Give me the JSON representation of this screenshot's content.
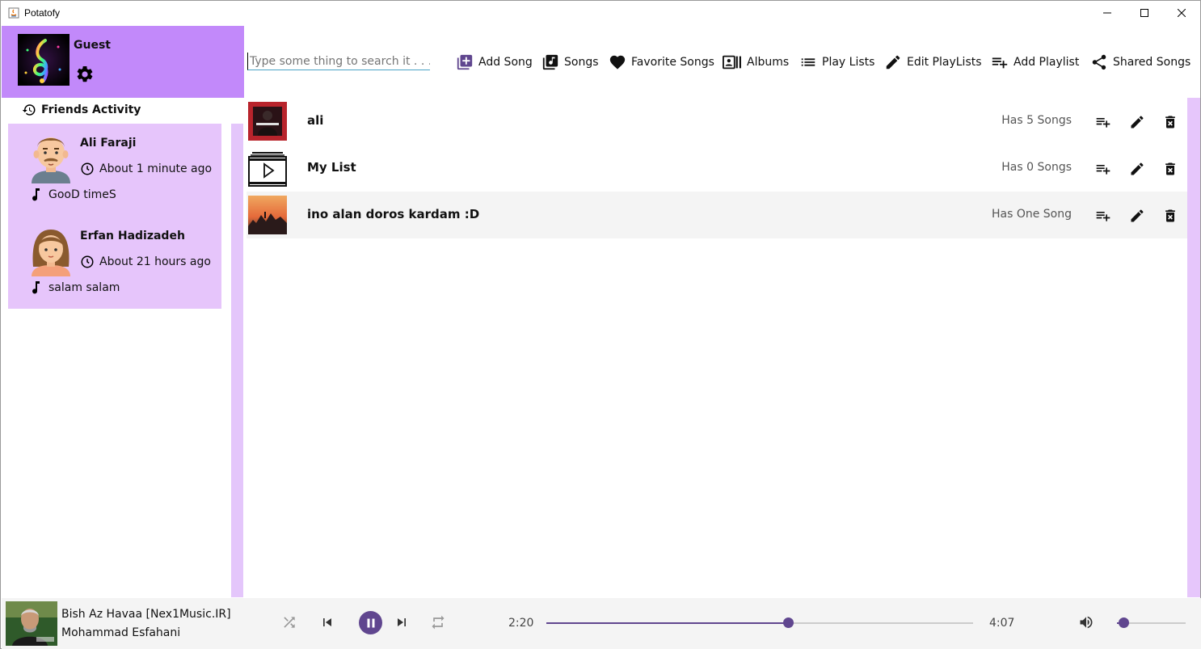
{
  "window": {
    "title": "Potatofy"
  },
  "profile": {
    "username": "Guest"
  },
  "friends": {
    "heading": "Friends Activity",
    "items": [
      {
        "name": "Ali Faraji",
        "time": "About 1 minute ago",
        "song": "GooD timeS"
      },
      {
        "name": "Erfan Hadizadeh",
        "time": "About 21 hours ago",
        "song": "salam salam"
      }
    ]
  },
  "search": {
    "placeholder": "Type some thing to search it . . ."
  },
  "nav": {
    "add_song": "Add Song",
    "songs": "Songs",
    "favorite_songs": "Favorite Songs",
    "albums": "Albums",
    "play_lists": "Play Lists",
    "edit_playlists": "Edit PlayLists",
    "add_playlist": "Add Playlist",
    "shared_songs": "Shared Songs"
  },
  "playlists": [
    {
      "name": "ali",
      "count": "Has 5 Songs"
    },
    {
      "name": "My List",
      "count": "Has 0 Songs"
    },
    {
      "name": "ino alan doros kardam :D",
      "count": "Has One Song"
    }
  ],
  "player": {
    "title": "Bish Az Havaa [Nex1Music.IR]",
    "artist": "Mohammad Esfahani",
    "elapsed": "2:20",
    "duration": "4:07",
    "progress_fraction": 0.567,
    "volume_fraction": 0.09
  },
  "colors": {
    "accent": "#60468f",
    "profile_bg": "#c289fa",
    "panel_bg": "#e6c5fb"
  }
}
